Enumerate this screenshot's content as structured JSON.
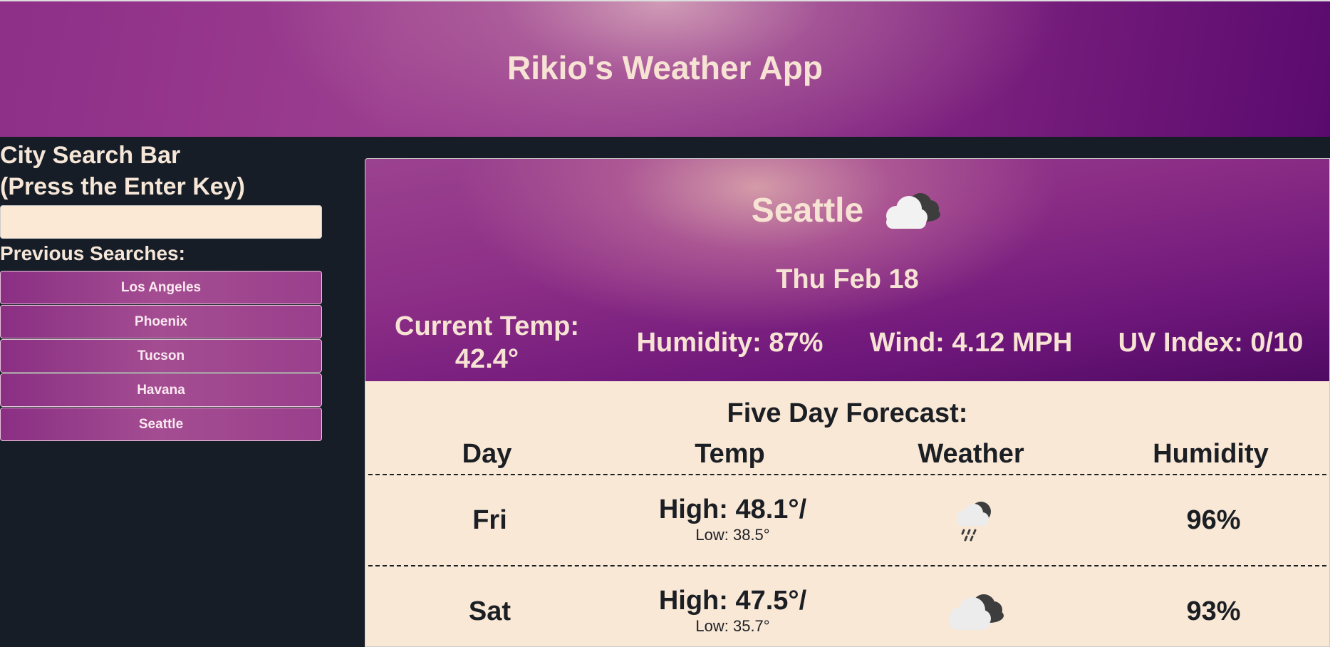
{
  "header": {
    "title": "Rikio's Weather App"
  },
  "search": {
    "title_line1": "City Search Bar",
    "title_line2": "(Press the Enter Key)",
    "value": "",
    "placeholder": ""
  },
  "previous": {
    "label": "Previous Searches:",
    "items": [
      "Los Angeles",
      "Phoenix",
      "Tucson",
      "Havana",
      "Seattle"
    ]
  },
  "current": {
    "city": "Seattle",
    "icon": "partly-cloudy-dark-icon",
    "date": "Thu Feb 18",
    "temp_label": "Current Temp:",
    "temp_value": "42.4°",
    "humidity": "Humidity: 87%",
    "wind": "Wind: 4.12 MPH",
    "uv": "UV Index: 0/10"
  },
  "forecast": {
    "title": "Five Day Forecast:",
    "columns": [
      "Day",
      "Temp",
      "Weather",
      "Humidity"
    ],
    "rows": [
      {
        "day": "Fri",
        "high": "High: 48.1°/",
        "low": "Low: 38.5°",
        "icon": "rain-cloud-icon",
        "humidity": "96%"
      },
      {
        "day": "Sat",
        "high": "High: 47.5°/",
        "low": "Low: 35.7°",
        "icon": "partly-cloudy-dark-icon",
        "humidity": "93%"
      }
    ]
  },
  "colors": {
    "background": "#161d26",
    "header_purple": "#8e2f88",
    "panel_cream": "#f9e8d6",
    "text_cream": "#f7e3d3",
    "text_dark": "#1b1f24"
  }
}
